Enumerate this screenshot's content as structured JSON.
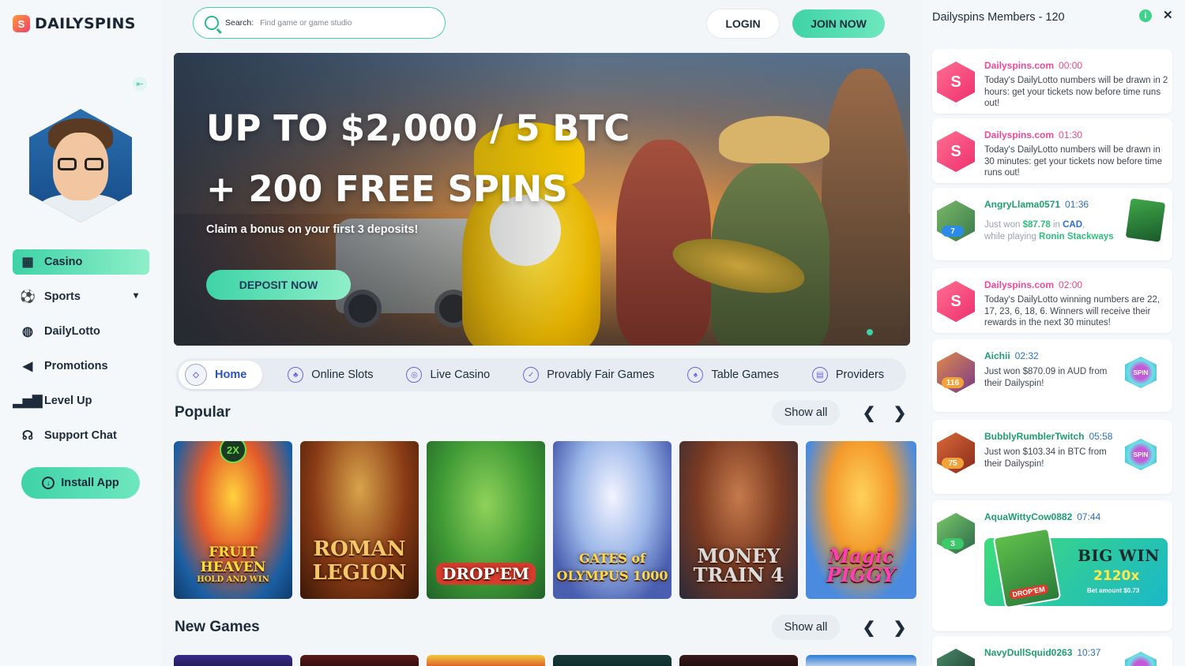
{
  "brand": {
    "name": "DAILYSPINS",
    "logo_glyph": "S",
    "accent": "#3ed3a6"
  },
  "header": {
    "search": {
      "label": "Search:",
      "placeholder": "Find game or game studio"
    },
    "login_label": "LOGIN",
    "join_label": "JOIN NOW"
  },
  "sidebar": {
    "items": [
      {
        "label": "Casino",
        "icon": "slot-machine-icon",
        "active": true
      },
      {
        "label": "Sports",
        "icon": "soccer-ball-icon",
        "active": false
      },
      {
        "label": "DailyLotto",
        "icon": "lottery-ball-icon",
        "active": false
      },
      {
        "label": "Promotions",
        "icon": "megaphone-icon",
        "active": false
      },
      {
        "label": "Level Up",
        "icon": "bar-chart-icon",
        "active": false
      },
      {
        "label": "Support Chat",
        "icon": "headset-icon",
        "active": false
      }
    ],
    "install_label": "Install App"
  },
  "hero": {
    "line1": "UP TO $2,000 / 5 BTC",
    "line2": "+ 200 FREE SPINS",
    "subtitle": "Claim a bonus on your first 3 deposits!",
    "cta": "DEPOSIT NOW"
  },
  "tabs": [
    {
      "label": "Home",
      "icon": "diamond-icon",
      "active": true
    },
    {
      "label": "Online Slots",
      "icon": "cherries-icon",
      "active": false
    },
    {
      "label": "Live Casino",
      "icon": "chips-icon",
      "active": false
    },
    {
      "label": "Provably Fair Games",
      "icon": "shield-check-icon",
      "active": false
    },
    {
      "label": "Table Games",
      "icon": "cards-icon",
      "active": false
    },
    {
      "label": "Providers",
      "icon": "provider-icon",
      "active": false
    }
  ],
  "popular": {
    "title": "Popular",
    "show_all": "Show all",
    "games": [
      {
        "title": "FRUIT HEAVEN",
        "sub": "HOLD AND WIN",
        "badge": "2X"
      },
      {
        "title": "ROMAN LEGION"
      },
      {
        "title": "DROP'EM"
      },
      {
        "title": "GATES of OLYMPUS 1000"
      },
      {
        "title": "MONEY TRAIN 4"
      },
      {
        "title": "Magic PIGGY"
      }
    ]
  },
  "new_games": {
    "title": "New Games",
    "show_all": "Show all"
  },
  "panel": {
    "title": "Dailyspins Members - 120",
    "messages": [
      {
        "name": "Dailyspins.com",
        "time": "00:00",
        "text": "Today's DailyLotto numbers will be drawn in 2 hours: get your tickets now before time runs out!"
      },
      {
        "name": "Dailyspins.com",
        "time": "01:30",
        "text": "Today's DailyLotto numbers will be drawn in 30 minutes: get your tickets now before time runs out!"
      },
      {
        "name": "AngryLlama0571",
        "time": "01:36",
        "level": "7",
        "pre": "Just won ",
        "amount": "$87.78",
        "in": " in ",
        "currency": "CAD",
        "tail": ",",
        "playing": "while playing ",
        "game": "Ronin Stackways"
      },
      {
        "name": "Dailyspins.com",
        "time": "02:00",
        "text": "Today's DailyLotto winning numbers are 22, 17, 23, 6, 18, 6. Winners will receive their rewards in the next 30 minutes!"
      },
      {
        "name": "Aichii",
        "time": "02:32",
        "level": "116",
        "text": "Just won $870.09 in AUD from their Dailyspin!",
        "badge": "SPIN"
      },
      {
        "name": "BubblyRumblerTwitch",
        "time": "05:58",
        "level": "75",
        "text": "Just won $103.34 in BTC from their Dailyspin!",
        "badge": "SPIN"
      },
      {
        "name": "AquaWittyCow0882",
        "time": "07:44",
        "level": "3",
        "bigwin": {
          "title": "BIG WIN",
          "multiplier": "2120x",
          "bet": "Bet amount $0.73",
          "game": "DROP'EM"
        }
      },
      {
        "name": "NavyDullSquid0263",
        "time": "10:37"
      }
    ]
  }
}
